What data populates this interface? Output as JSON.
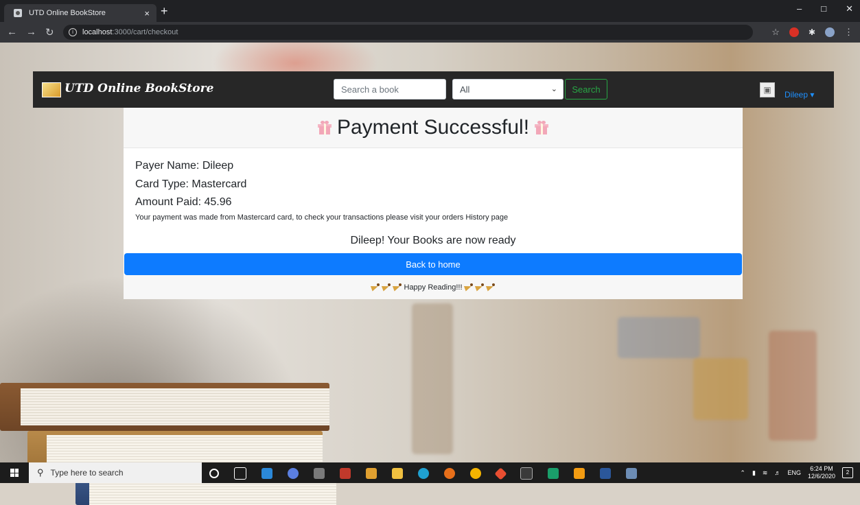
{
  "browser": {
    "tab_title": "UTD Online BookStore",
    "tab_close": "×",
    "new_tab": "+",
    "url_host": "localhost",
    "url_rest": ":3000/cart/checkout"
  },
  "navbar": {
    "brand": "UTD Online BookStore",
    "search_placeholder": "Search a book",
    "category_selected": "All",
    "search_button": "Search",
    "user_name": "Dileep ▾"
  },
  "payment": {
    "title": "Payment Successful!",
    "payer_name": "Payer Name: Dileep",
    "card_type": "Card Type: Mastercard",
    "amount_paid": "Amount Paid: 45.96",
    "note": "Your payment was made from Mastercard card, to check your transactions please visit your orders History page",
    "ready_message": "Dileep! Your Books are now ready",
    "back_home": "Back to home",
    "footer": "Happy Reading!!!"
  },
  "taskbar": {
    "search_placeholder": "Type here to search",
    "language": "ENG",
    "time": "6:24 PM",
    "date": "12/6/2020",
    "notifications": "2"
  },
  "colors": {
    "navbar": "#272727",
    "primary_button": "#0d7bff",
    "search_button": "#28a745",
    "user_link": "#1e90ff"
  }
}
